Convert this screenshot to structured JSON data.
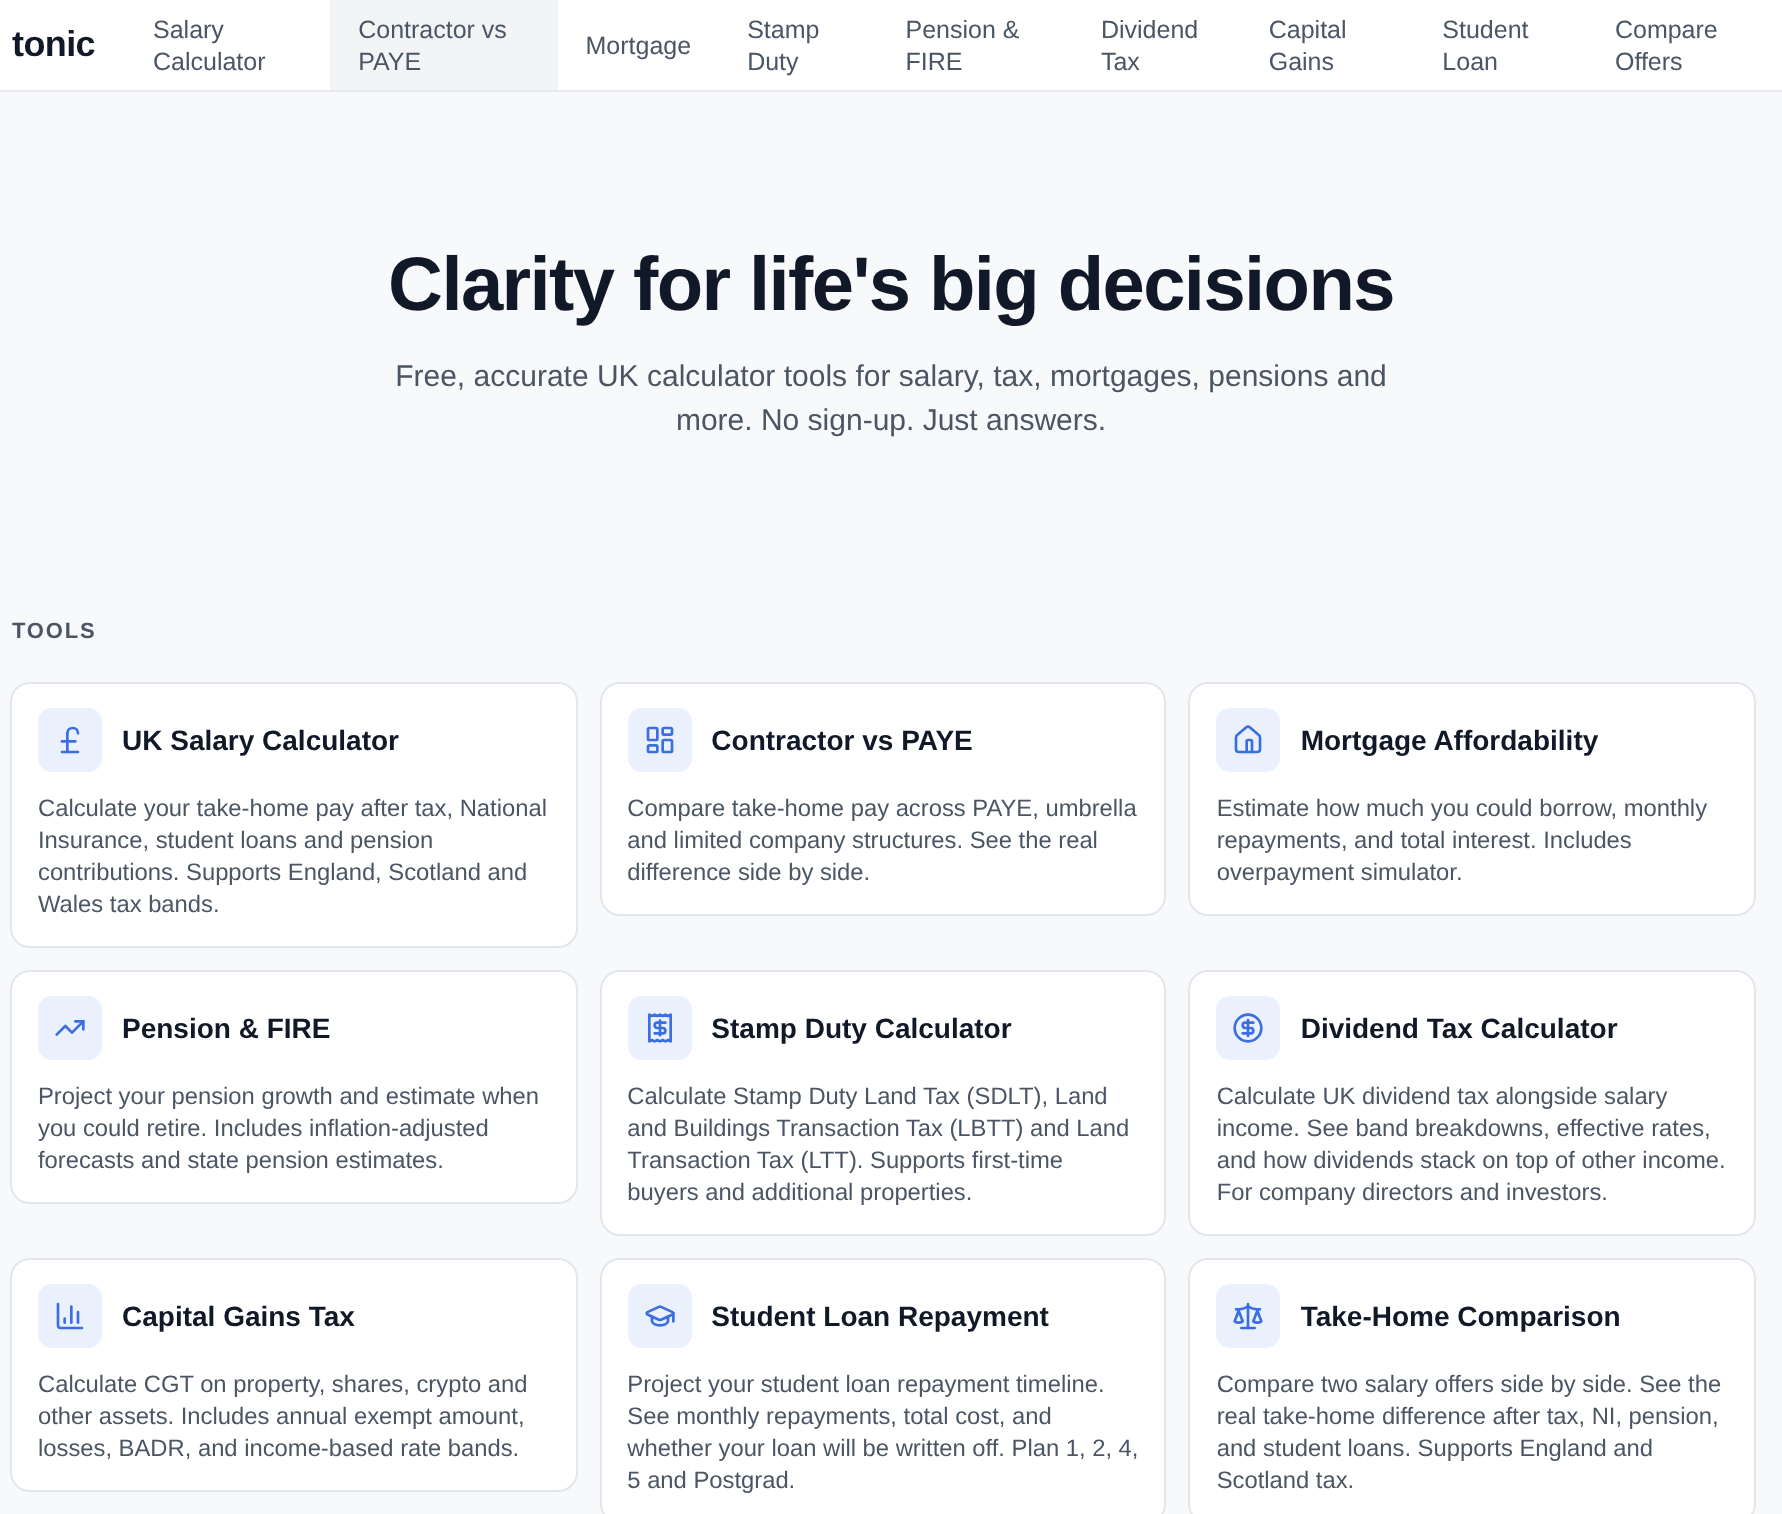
{
  "header": {
    "logo": "tonic",
    "nav": [
      {
        "label": "Salary Calculator",
        "selected": false
      },
      {
        "label": "Contractor vs PAYE",
        "selected": true
      },
      {
        "label": "Mortgage",
        "selected": false
      },
      {
        "label": "Stamp Duty",
        "selected": false
      },
      {
        "label": "Pension & FIRE",
        "selected": false
      },
      {
        "label": "Dividend Tax",
        "selected": false
      },
      {
        "label": "Capital Gains",
        "selected": false
      },
      {
        "label": "Student Loan",
        "selected": false
      },
      {
        "label": "Compare Offers",
        "selected": false
      }
    ]
  },
  "hero": {
    "title": "Clarity for life's big decisions",
    "subtitle": "Free, accurate UK calculator tools for salary, tax, mortgages, pensions and more. No sign-up. Just answers."
  },
  "tools": {
    "heading": "TOOLS",
    "cards": [
      {
        "kind": "salary",
        "title": "UK Salary Calculator",
        "description": "Calculate your take-home pay after tax, National Insurance, student loans and pension contributions. Supports England, Scotland and Wales tax bands."
      },
      {
        "kind": "contractor",
        "title": "Contractor vs PAYE",
        "description": "Compare take-home pay across PAYE, umbrella and limited company structures. See the real difference side by side."
      },
      {
        "kind": "mortgage",
        "title": "Mortgage Affordability",
        "description": "Estimate how much you could borrow, monthly repayments, and total interest. Includes overpayment simulator."
      },
      {
        "kind": "pension",
        "title": "Pension & FIRE",
        "description": "Project your pension growth and estimate when you could retire. Includes inflation-adjusted forecasts and state pension estimates."
      },
      {
        "kind": "stampduty",
        "title": "Stamp Duty Calculator",
        "description": "Calculate Stamp Duty Land Tax (SDLT), Land and Buildings Transaction Tax (LBTT) and Land Transaction Tax (LTT). Supports first-time buyers and additional properties."
      },
      {
        "kind": "dividend",
        "title": "Dividend Tax Calculator",
        "description": "Calculate UK dividend tax alongside salary income. See band breakdowns, effective rates, and how dividends stack on top of other income. For company directors and investors."
      },
      {
        "kind": "gains",
        "title": "Capital Gains Tax",
        "description": "Calculate CGT on property, shares, crypto and other assets. Includes annual exempt amount, losses, BADR, and income-based rate bands."
      },
      {
        "kind": "loan",
        "title": "Student Loan Repayment",
        "description": "Project your student loan repayment timeline. See monthly repayments, total cost, and whether your loan will be written off. Plan 1, 2, 4, 5 and Postgrad."
      },
      {
        "kind": "comparison",
        "title": "Take-Home Comparison",
        "description": "Compare two salary offers side by side. See the real take-home difference after tax, NI, pension, and student loans. Supports England and Scotland tax."
      }
    ]
  }
}
